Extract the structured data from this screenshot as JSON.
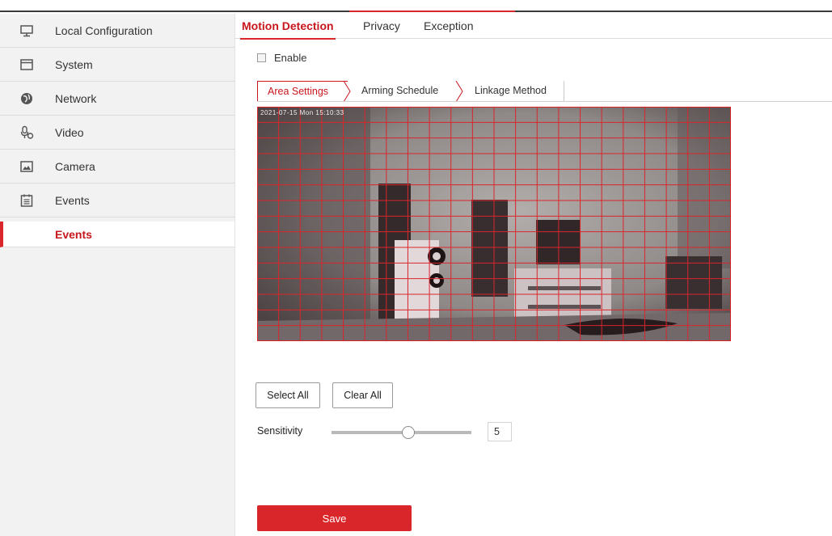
{
  "colors": {
    "accent": "#d9262b",
    "accent_text": "#c8161d",
    "sidebar_bg": "#f2f2f2"
  },
  "sidebar": {
    "items": [
      {
        "label": "Local Configuration",
        "icon": "monitor-icon"
      },
      {
        "label": "System",
        "icon": "window-icon"
      },
      {
        "label": "Network",
        "icon": "globe-icon"
      },
      {
        "label": "Video",
        "icon": "microphone-icon"
      },
      {
        "label": "Camera",
        "icon": "image-icon"
      },
      {
        "label": "Events",
        "icon": "calendar-icon"
      }
    ],
    "active_sub": "Events"
  },
  "tabs": [
    "Motion Detection",
    "Privacy",
    "Exception"
  ],
  "enable": {
    "label": "Enable",
    "checked": false
  },
  "subtabs": [
    "Area Settings",
    "Arming Schedule",
    "Linkage Method"
  ],
  "video": {
    "osd": "2021-07-15 Mon 15:10:33",
    "grid_cols": 22,
    "grid_rows": 15
  },
  "buttons": {
    "select_all": "Select All",
    "clear_all": "Clear All",
    "save": "Save"
  },
  "sensitivity": {
    "label": "Sensitivity",
    "value": "5",
    "level_fraction": 0.55
  }
}
